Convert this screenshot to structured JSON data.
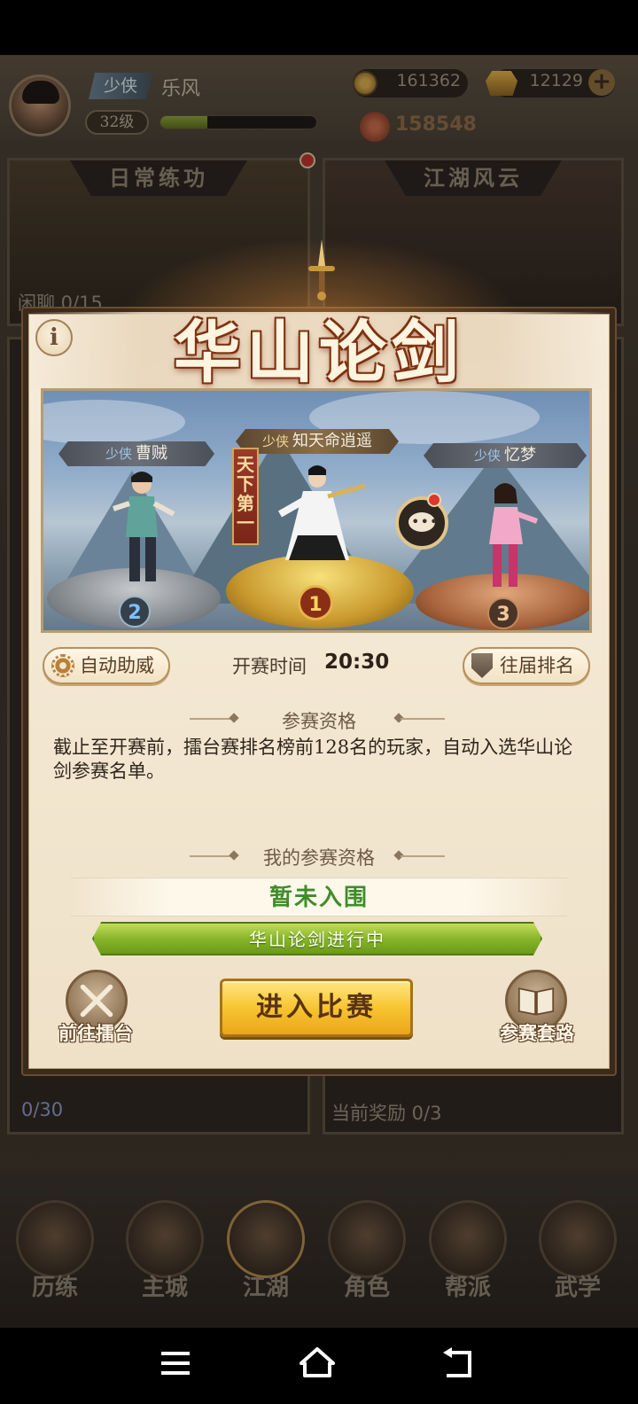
{
  "header": {
    "player_rank": "少侠",
    "player_name": "乐风",
    "level": "32级",
    "exp_fraction": 0.3,
    "coins": "161362",
    "gold": "12129",
    "power": "158548"
  },
  "background_cards": [
    {
      "title": "日常练功",
      "footer": "闲聊 0/15"
    },
    {
      "title": "江湖风云",
      "footer": ""
    },
    {
      "title": "",
      "footer": "0/30"
    },
    {
      "title": "",
      "footer": "当前奖励 0/3"
    }
  ],
  "modal": {
    "title": "华山论剑",
    "info_icon": "i",
    "fighters": [
      {
        "rank_title": "少侠",
        "name": "曹贼",
        "place": "2"
      },
      {
        "rank_title": "少侠",
        "name": "知天命逍遥",
        "place": "1"
      },
      {
        "rank_title": "少侠",
        "name": "忆梦",
        "place": "3"
      }
    ],
    "champion_banner": "天下第一",
    "auto_cheer_label": "自动助威",
    "start_time_label": "开赛时间",
    "start_time_value": "20:30",
    "past_rankings_label": "往届排名",
    "eligibility_heading": "参赛资格",
    "eligibility_text": "截止至开赛前，擂台赛排名榜前128名的玩家，自动入选华山论剑参赛名单。",
    "my_eligibility_heading": "我的参赛资格",
    "my_status": "暂未入围",
    "progress_text": "华山论剑进行中",
    "go_arena_label": "前往擂台",
    "enter_button_label": "进入比赛",
    "tactics_label": "参赛套路"
  },
  "bottom_nav": [
    {
      "label": "历练",
      "icon": "training-icon"
    },
    {
      "label": "主城",
      "icon": "city-icon"
    },
    {
      "label": "江湖",
      "icon": "jianghu-icon"
    },
    {
      "label": "角色",
      "icon": "character-icon"
    },
    {
      "label": "帮派",
      "icon": "guild-icon"
    },
    {
      "label": "武学",
      "icon": "martial-arts-icon"
    }
  ],
  "system_nav": {
    "menu": "menu-icon",
    "home": "home-icon",
    "back": "back-icon"
  },
  "colors": {
    "accent_gold": "#f7c531",
    "status_green": "#3f8c2a",
    "progress_green": "#88b52a",
    "title_red": "#7c2f10"
  }
}
